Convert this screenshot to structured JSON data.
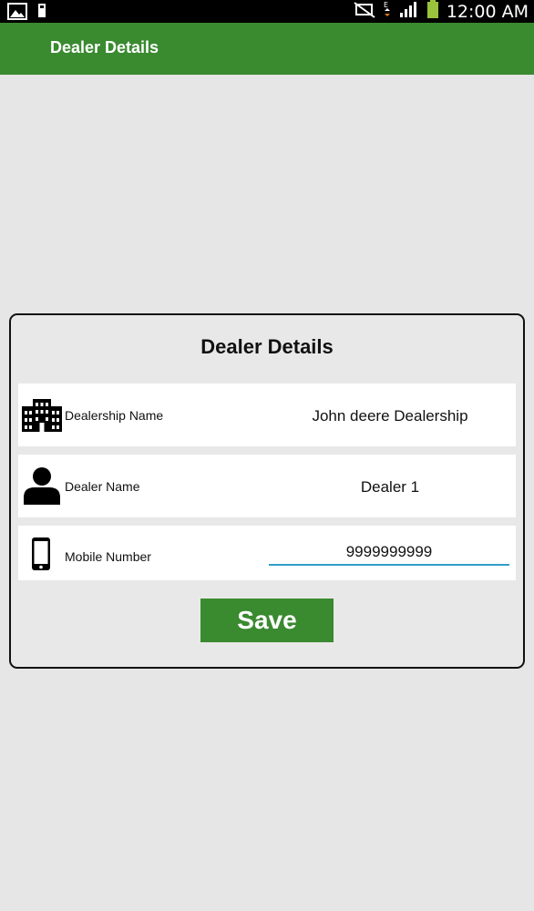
{
  "status_bar": {
    "time": "12:00 AM",
    "icons": [
      "image-icon",
      "sd-card-icon",
      "mute-icon",
      "data-arrows-icon",
      "signal-icon",
      "battery-icon"
    ]
  },
  "appbar": {
    "title": "Dealer Details"
  },
  "card": {
    "title": "Dealer Details",
    "fields": {
      "dealership": {
        "label": "Dealership Name",
        "value": "John deere Dealership",
        "icon": "building-icon"
      },
      "dealer": {
        "label": "Dealer Name",
        "value": "Dealer 1",
        "icon": "person-icon"
      },
      "mobile": {
        "label": "Mobile Number",
        "value": "9999999999",
        "icon": "phone-icon"
      }
    },
    "save_label": "Save"
  },
  "colors": {
    "primary": "#3a8a30",
    "background": "#e6e6e6",
    "input_underline": "#2f9ec9"
  }
}
